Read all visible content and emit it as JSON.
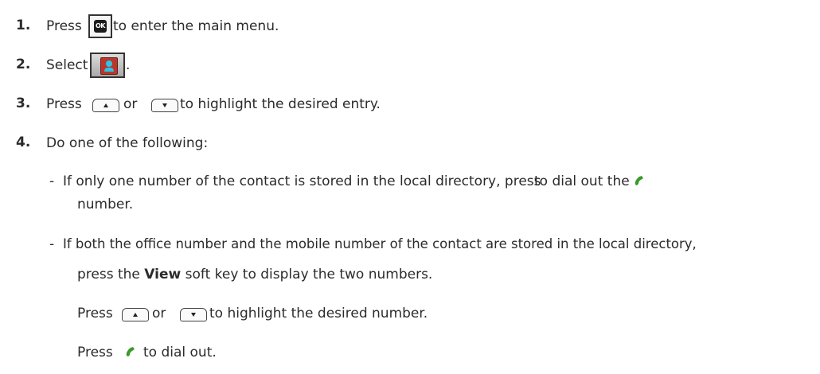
{
  "steps": [
    {
      "num": "1.",
      "text_before": "Press",
      "text_after": "to enter the main menu."
    },
    {
      "num": "2.",
      "text_before": "Select",
      "text_after": "."
    },
    {
      "num": "3.",
      "text_before": "Press",
      "text_mid": "or",
      "text_after": "to highlight the desired entry."
    },
    {
      "num": "4.",
      "text": "Do one of the following:"
    }
  ],
  "ok_key_label": "OK",
  "bullet_a": {
    "dash": "-",
    "text_before": "If only one number of the contact is stored in the local directory, press",
    "text_after": "to dial out the",
    "text_cont": "number."
  },
  "bullet_b": {
    "dash": "-",
    "line1": "If both the office number and the mobile number of the contact are stored in the local directory,",
    "line2_before": "press the",
    "line2_bold": "View",
    "line2_after": "soft key to display the two numbers.",
    "line3_before": "Press",
    "line3_mid": "or",
    "line3_after": "to highlight the desired number.",
    "line4_before": "Press",
    "line4_after": "to dial out."
  },
  "colors": {
    "handset": "#3a9a2a",
    "directory_book": "#b8372d",
    "directory_person": "#2ec4e6"
  },
  "icons": [
    "ok-key-icon",
    "directory-icon",
    "up-arrow-key-icon",
    "down-arrow-key-icon",
    "green-handset-icon"
  ]
}
